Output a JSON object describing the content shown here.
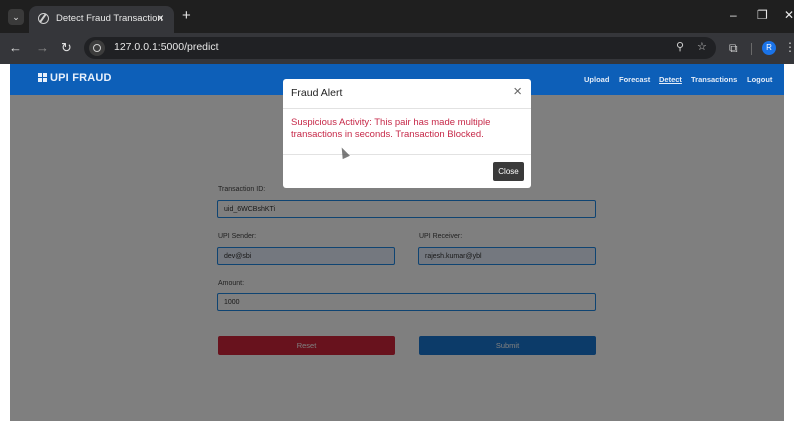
{
  "browser": {
    "tab_title": "Detect Fraud Transaction",
    "tab_close": "×",
    "new_tab": "+",
    "url": "127.0.0.1:5000/predict",
    "window_controls": {
      "minimize": "–",
      "maximize": "❐",
      "close": "✕"
    },
    "profile_initial": "R"
  },
  "navbar": {
    "brand": "UPI FRAUD",
    "links": [
      "Upload",
      "Forecast",
      "Detect",
      "Transactions",
      "Logout"
    ],
    "active": "Detect"
  },
  "form": {
    "transaction_id_label": "Transaction ID:",
    "transaction_id_value": "uid_6WCBshKTi",
    "upi_sender_label": "UPI Sender:",
    "upi_sender_value": "dev@sbi",
    "upi_receiver_label": "UPI Receiver:",
    "upi_receiver_value": "rajesh.kumar@ybl",
    "amount_label": "Amount:",
    "amount_value": "1000",
    "reset_label": "Reset",
    "submit_label": "Submit"
  },
  "modal": {
    "title": "Fraud Alert",
    "message": "Suspicious Activity: This pair has made multiple transactions in seconds. Transaction Blocked.",
    "close_label": "Close",
    "close_x": "×"
  },
  "colors": {
    "navbar": "#0d5fb8",
    "alert_text": "#c62848",
    "reset_button": "#d0243a",
    "submit_button": "#1976d2"
  }
}
